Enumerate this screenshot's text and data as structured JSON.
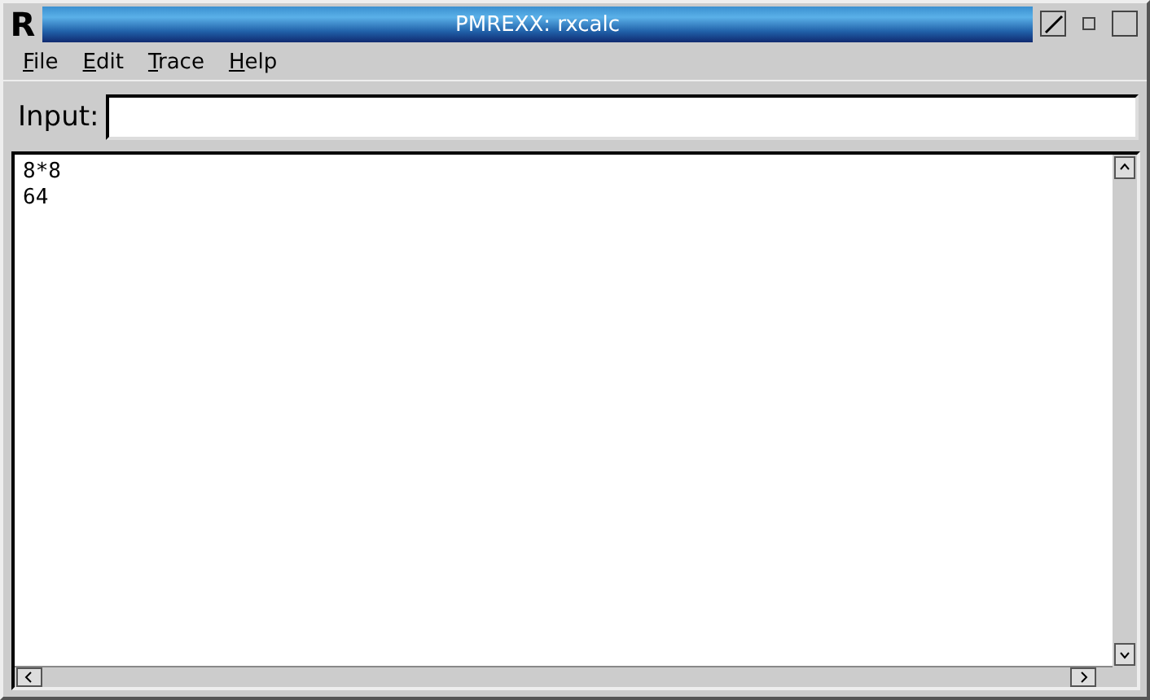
{
  "window": {
    "title": "PMREXX: rxcalc",
    "system_menu": "R"
  },
  "menu": [
    {
      "label": "File"
    },
    {
      "label": "Edit"
    },
    {
      "label": "Trace"
    },
    {
      "label": "Help"
    }
  ],
  "input": {
    "label": "Input:"
  },
  "output": {
    "lines": [
      "8*8",
      "64"
    ]
  }
}
